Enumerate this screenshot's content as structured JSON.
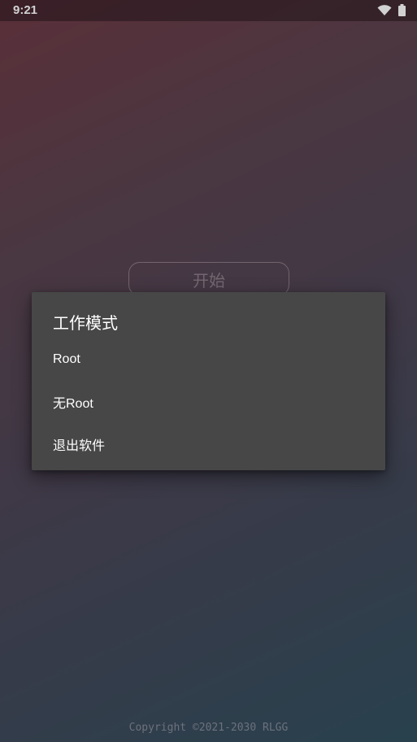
{
  "status_bar": {
    "time": "9:21",
    "icons": [
      "wifi-icon",
      "battery-icon"
    ]
  },
  "main": {
    "start_label": "开始"
  },
  "dialog": {
    "title": "工作模式",
    "items": [
      {
        "label": "Root"
      },
      {
        "label": "无Root"
      },
      {
        "label": "退出软件"
      }
    ]
  },
  "footer": {
    "copyright": "Copyright ©2021-2030 RLGG"
  },
  "colors": {
    "dialog_bg": "#474747",
    "gradient_top": "#6e3a46",
    "gradient_bottom": "#32505f",
    "text": "#ffffff"
  }
}
